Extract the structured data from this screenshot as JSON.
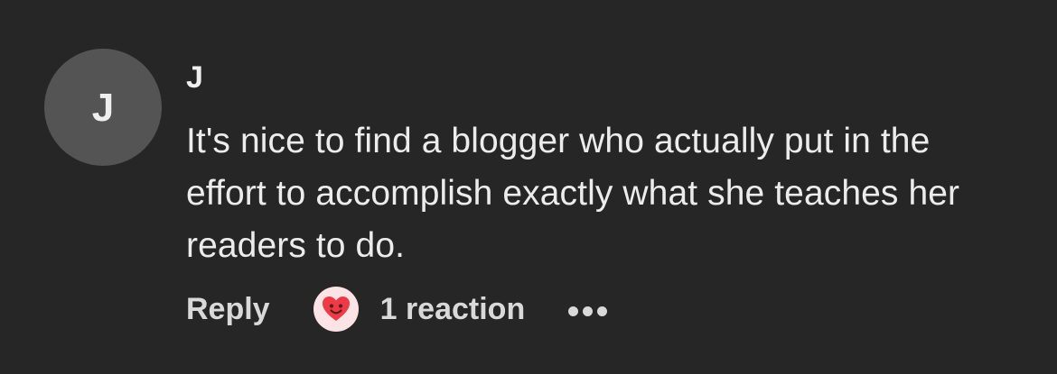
{
  "comment": {
    "avatar_initial": "J",
    "author": "J",
    "text": "It's nice to find a blogger who actually put in the effort to accomplish exactly what she teaches her readers to do.",
    "actions": {
      "reply_label": "Reply",
      "reaction_icon": "smiling-heart-icon",
      "reaction_count_label": "1 reaction",
      "more_icon": "more-options-icon"
    }
  },
  "colors": {
    "background": "#262626",
    "avatar_bg": "#545454",
    "text": "#ececec",
    "reaction_bg": "#fbe3e6",
    "heart": "#ee3a45"
  }
}
